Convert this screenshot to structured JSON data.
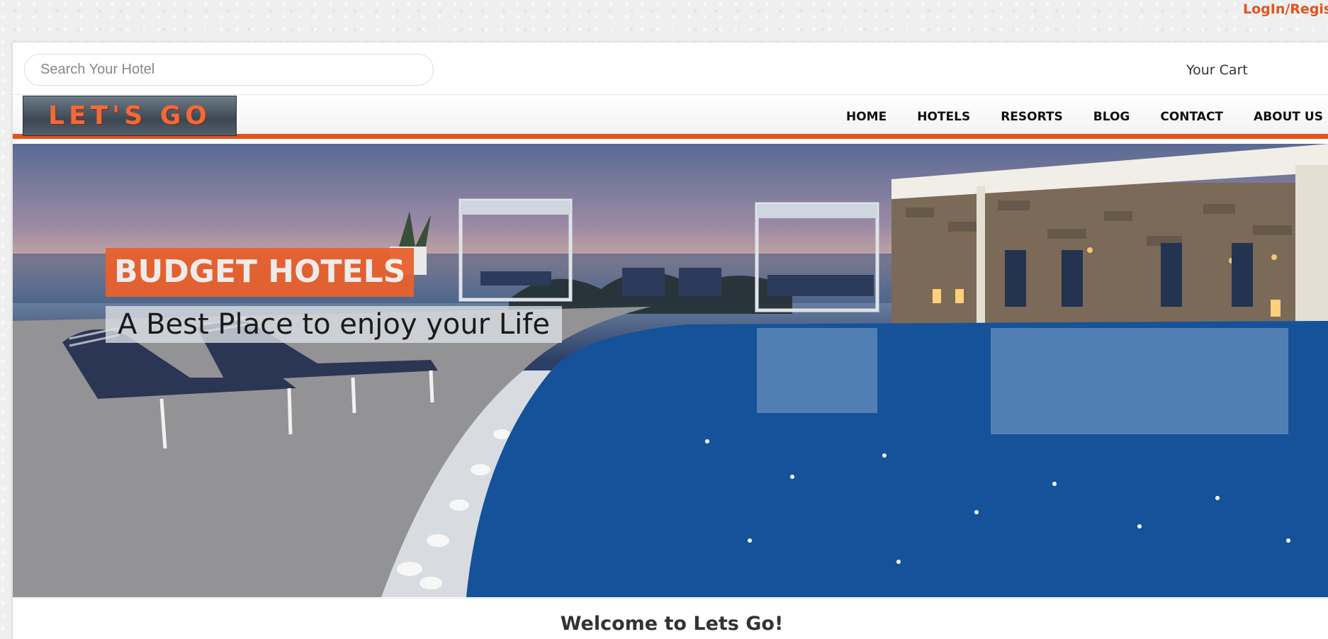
{
  "header": {
    "login_label": "LogIn/Regist"
  },
  "topbar": {
    "search_placeholder": "Search Your Hotel",
    "cart_label": "Your Cart"
  },
  "brand": {
    "logo_text": "LET'S GO",
    "accent_color": "#e8501c"
  },
  "nav": {
    "items": [
      "HOME",
      "HOTELS",
      "RESORTS",
      "BLOG",
      "CONTACT",
      "ABOUT US"
    ]
  },
  "hero": {
    "title": "BUDGET HOTELS",
    "subtitle": "A Best Place to enjoy your Life"
  },
  "welcome": {
    "heading": "Welcome to Lets Go!"
  }
}
